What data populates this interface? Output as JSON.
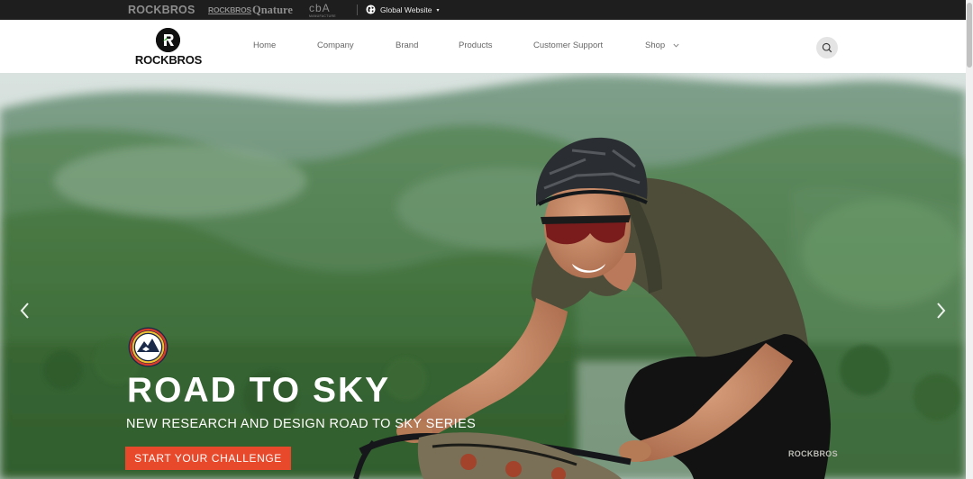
{
  "topbar": {
    "brands": [
      "ROCKBROS",
      "ROCKBROS",
      "Qnature",
      "cbA"
    ],
    "cba_sub": "MANUFACTURE",
    "global_label": "Global Website",
    "global_icon": "globe-icon",
    "global_caret": "▾"
  },
  "nav": {
    "logo_text": "ROCKBROS",
    "items": [
      {
        "label": "Home"
      },
      {
        "label": "Company"
      },
      {
        "label": "Brand"
      },
      {
        "label": "Products"
      },
      {
        "label": "Customer Support"
      },
      {
        "label": "Shop",
        "icon": "chevron-down-icon"
      }
    ],
    "search_icon": "search-icon"
  },
  "hero": {
    "title": "ROAD TO SKY",
    "subtitle": "NEW RESEARCH AND DESIGN ROAD TO SKY SERIES",
    "cta_label": "START YOUR CHALLENGE",
    "jersey_text": "ROCKBROS",
    "prev_icon": "chevron-left-icon",
    "next_icon": "chevron-right-icon"
  },
  "colors": {
    "topbar_bg": "#1e1e1e",
    "nav_bg": "#ffffff",
    "accent": "#e8492b",
    "brand_gray": "#8d8d8d"
  }
}
